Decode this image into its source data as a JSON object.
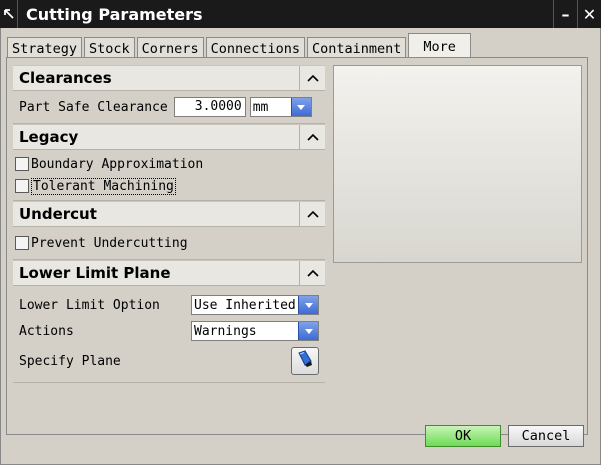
{
  "window": {
    "title": "Cutting Parameters",
    "minimize_label": "–",
    "close_label": "✕"
  },
  "tabs": [
    {
      "label": "Strategy"
    },
    {
      "label": "Stock"
    },
    {
      "label": "Corners"
    },
    {
      "label": "Connections"
    },
    {
      "label": "Containment"
    },
    {
      "label": "More",
      "active": true
    }
  ],
  "sections": {
    "clearances": {
      "title": "Clearances",
      "part_safe_label": "Part Safe Clearance",
      "part_safe_value": "3.0000",
      "unit": "mm"
    },
    "legacy": {
      "title": "Legacy",
      "boundary_label": "Boundary Approximation",
      "boundary_checked": false,
      "tolerant_label": "Tolerant Machining",
      "tolerant_checked": false
    },
    "undercut": {
      "title": "Undercut",
      "prevent_label": "Prevent Undercutting",
      "prevent_checked": false
    },
    "lower_limit": {
      "title": "Lower Limit Plane",
      "option_label": "Lower Limit Option",
      "option_value": "Use Inherited",
      "actions_label": "Actions",
      "actions_value": "Warnings",
      "specify_label": "Specify Plane"
    }
  },
  "footer": {
    "ok_label": "OK",
    "cancel_label": "Cancel"
  },
  "colors": {
    "titlebar": "#1a1a1a",
    "ok_button": "#6ddc55",
    "dropdown_blue": "#3d6bd6"
  }
}
